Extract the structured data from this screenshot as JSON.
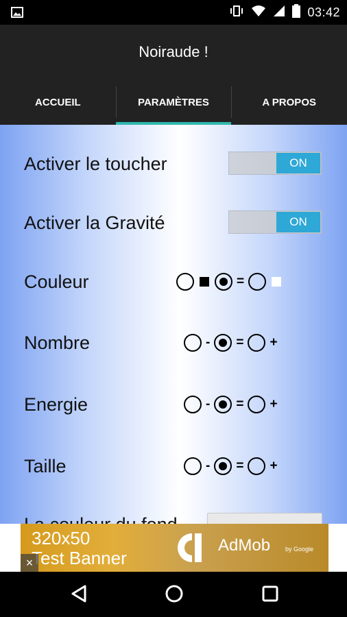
{
  "status_bar": {
    "time": "03:42",
    "icons": [
      "image-icon",
      "vibrate-icon",
      "wifi-icon",
      "signal-icon",
      "battery-icon"
    ]
  },
  "app": {
    "title": "Noiraude !"
  },
  "tabs": [
    {
      "label": "ACCUEIL",
      "active": false
    },
    {
      "label": "PARAMÈTRES",
      "active": true
    },
    {
      "label": "A PROPOS",
      "active": false
    }
  ],
  "settings": {
    "touch": {
      "label": "Activer le toucher",
      "state": "ON"
    },
    "gravity": {
      "label": "Activer la Gravité",
      "state": "ON"
    },
    "color": {
      "label": "Couleur",
      "options": [
        "black",
        "=",
        "white"
      ],
      "selected": 1
    },
    "number": {
      "label": "Nombre",
      "options": [
        "-",
        "=",
        "+"
      ],
      "selected": 1
    },
    "energy": {
      "label": "Energie",
      "options": [
        "-",
        "=",
        "+"
      ],
      "selected": 1
    },
    "size": {
      "label": "Taille",
      "options": [
        "-",
        "=",
        "+"
      ],
      "selected": 1
    },
    "partial_row": {
      "label": "La couleur du fond"
    }
  },
  "ad_banner": {
    "line1": "320x50",
    "line2": "Test Banner",
    "close": "×",
    "brand": "AdMob",
    "brand_sub": "by Google"
  },
  "colors": {
    "accent": "#2fb7ad",
    "switch_on": "#2ea8d6",
    "action_bar": "#222222"
  }
}
